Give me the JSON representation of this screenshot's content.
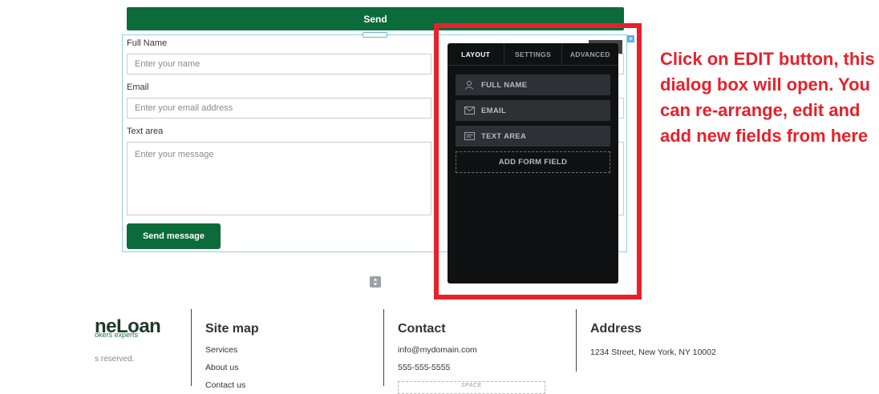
{
  "form": {
    "top_button_label": "Send",
    "full_name_label": "Full Name",
    "full_name_placeholder": "Enter your name",
    "email_label": "Email",
    "email_placeholder": "Enter your email address",
    "textarea_label": "Text area",
    "textarea_placeholder": "Enter your message",
    "submit_label": "Send message"
  },
  "panel": {
    "tabs": [
      "LAYOUT",
      "SETTINGS",
      "ADVANCED"
    ],
    "active_tab": "LAYOUT",
    "items": [
      {
        "label": "FULL NAME",
        "icon": "person-icon"
      },
      {
        "label": "EMAIL",
        "icon": "envelope-icon"
      },
      {
        "label": "TEXT AREA",
        "icon": "textarea-icon"
      }
    ],
    "add_field_label": "ADD FORM FIELD"
  },
  "annotation": {
    "text": "Click on EDIT button, this dialog box will open. You can re-arrange, edit and add new fields from here",
    "color": "#e8202a"
  },
  "footer": {
    "logo_text": "neLoan",
    "logo_sub": "okers experts",
    "rights": "s reserved.",
    "sitemap": {
      "title": "Site map",
      "links": [
        "Services",
        "About us",
        "Contact us"
      ]
    },
    "contact": {
      "title": "Contact",
      "email": "info@mydomain.com",
      "phone": "555-555-5555",
      "space_label": "SPACE"
    },
    "address": {
      "title": "Address",
      "line": "1234 Street, New York, NY 10002"
    }
  },
  "colors": {
    "brand_green": "#0b6b3a",
    "panel_bg": "#0f1113",
    "highlight_red": "#e8202a"
  }
}
